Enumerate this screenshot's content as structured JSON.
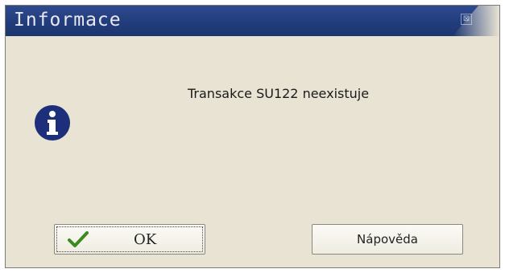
{
  "dialog": {
    "title": "Informace",
    "close_glyph": "⊠",
    "message": "Transakce SU122 neexistuje",
    "icon": "info-icon"
  },
  "buttons": {
    "ok_label": "OK",
    "ok_icon": "checkmark-icon",
    "help_label": "Nápověda"
  },
  "colors": {
    "titlebar": "#243f7f",
    "dialog_bg": "#e8e3d3",
    "info_icon": "#1d2f7a",
    "checkmark": "#3b8a1e"
  }
}
